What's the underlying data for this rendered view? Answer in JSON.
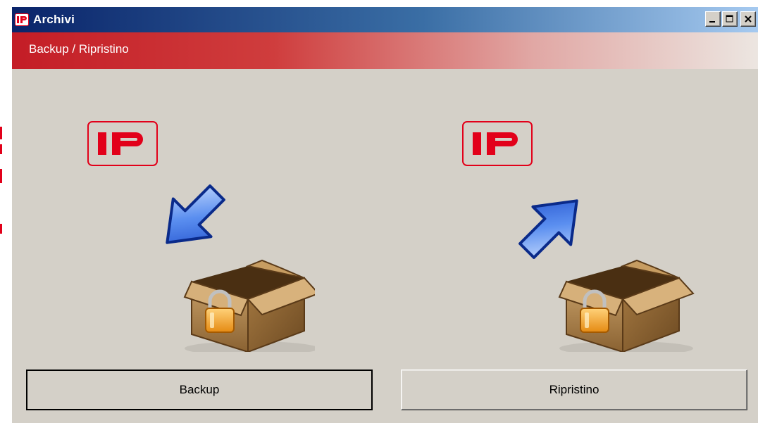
{
  "window": {
    "title": "Archivi",
    "app_icon": "ip-logo-icon",
    "controls": [
      "minimize-icon",
      "maximize-icon",
      "close-icon"
    ]
  },
  "banner": {
    "text": "Backup / Ripristino"
  },
  "backup_panel": {
    "logo_text": "IP",
    "arrow": "arrow-down-right-icon",
    "box": "locked-box-icon",
    "button_label": "Backup"
  },
  "restore_panel": {
    "logo_text": "IP",
    "arrow": "arrow-up-left-icon",
    "box": "locked-box-icon",
    "button_label": "Ripristino"
  },
  "colors": {
    "brand_red": "#e2001a",
    "arrow_blue": "#2f6ee8",
    "window_bg": "#d4d0c8"
  }
}
